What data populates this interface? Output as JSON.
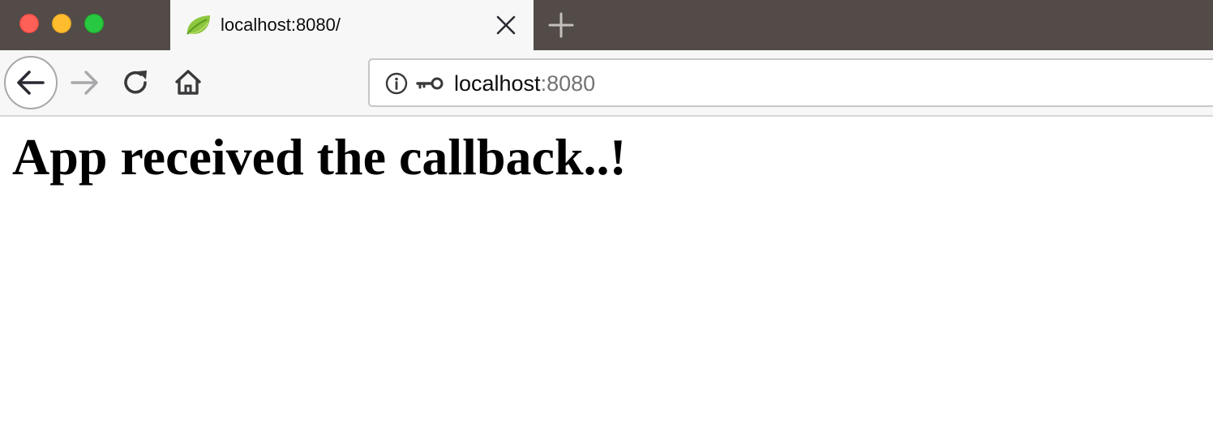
{
  "window": {
    "controls": [
      "close",
      "minimize",
      "zoom"
    ],
    "colors": {
      "close": "#fe5f57",
      "minimize": "#febc2e",
      "zoom": "#28c840"
    }
  },
  "tab": {
    "favicon": "spring-leaf-icon",
    "title": "localhost:8080/",
    "close_icon": "close-icon"
  },
  "new_tab_icon": "plus-icon",
  "toolbar": {
    "back_icon": "arrow-left-icon",
    "forward_icon": "arrow-right-icon",
    "reload_icon": "reload-icon",
    "home_icon": "home-icon"
  },
  "urlbar": {
    "info_icon": "info-icon",
    "key_icon": "key-icon",
    "host": "localhost",
    "port": ":8080"
  },
  "page": {
    "heading": "App received the callback..!"
  }
}
